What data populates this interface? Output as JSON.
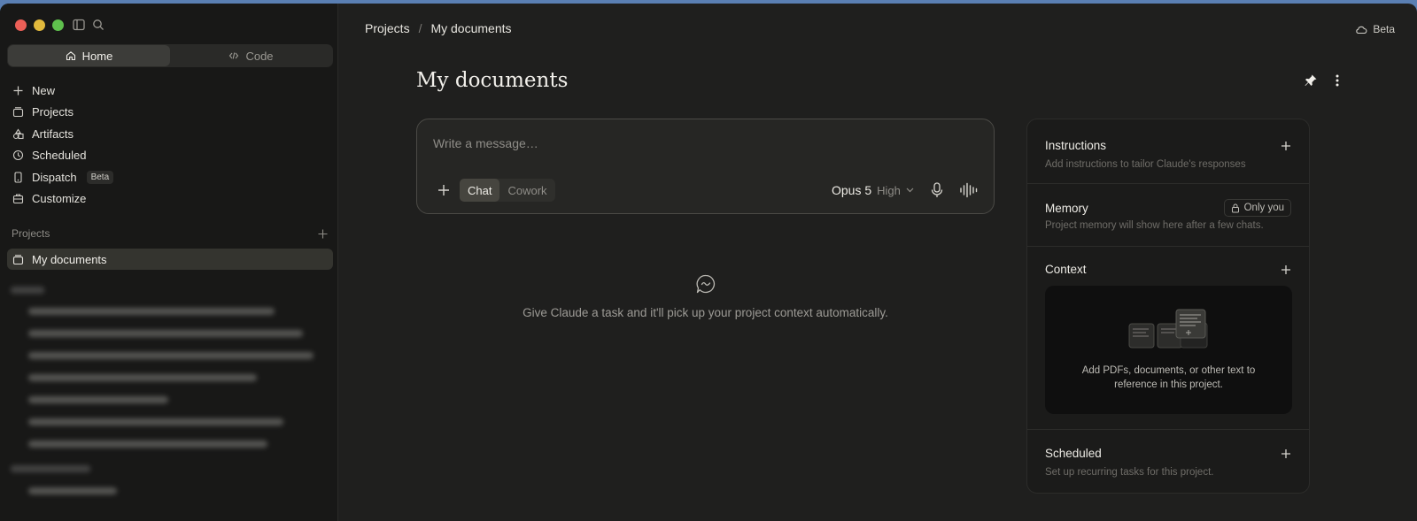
{
  "sidebar": {
    "tabs": [
      {
        "label": "Home",
        "icon": "home-icon",
        "active": true
      },
      {
        "label": "Code",
        "icon": "code-icon",
        "active": false
      }
    ],
    "nav_items": [
      {
        "label": "New",
        "icon": "plus-icon"
      },
      {
        "label": "Projects",
        "icon": "folder-icon"
      },
      {
        "label": "Artifacts",
        "icon": "shapes-icon"
      },
      {
        "label": "Scheduled",
        "icon": "clock-icon"
      },
      {
        "label": "Dispatch",
        "icon": "phone-icon",
        "badge": "Beta"
      },
      {
        "label": "Customize",
        "icon": "briefcase-icon"
      }
    ],
    "projects_section": {
      "label": "Projects"
    },
    "active_project": {
      "label": "My documents",
      "icon": "folder-icon"
    }
  },
  "header": {
    "breadcrumb": [
      "Projects",
      "My documents"
    ],
    "beta_label": "Beta"
  },
  "main": {
    "title": "My documents",
    "composer": {
      "placeholder": "Write a message…",
      "modes": [
        {
          "label": "Chat",
          "active": true
        },
        {
          "label": "Cowork",
          "active": false
        }
      ],
      "model": "Opus 5",
      "effort": "High"
    },
    "empty_state": "Give Claude a task and it'll pick up your project context automatically."
  },
  "panel": {
    "instructions": {
      "title": "Instructions",
      "subtitle": "Add instructions to tailor Claude's responses"
    },
    "memory": {
      "title": "Memory",
      "subtitle": "Project memory will show here after a few chats.",
      "visibility": "Only you"
    },
    "context": {
      "title": "Context",
      "dropzone_text": "Add PDFs, documents, or other text to reference in this project."
    },
    "scheduled": {
      "title": "Scheduled",
      "subtitle": "Set up recurring tasks for this project."
    }
  },
  "colors": {
    "background": "#1f1f1e",
    "sidebar": "#181817",
    "accent_active": "#34342f"
  }
}
